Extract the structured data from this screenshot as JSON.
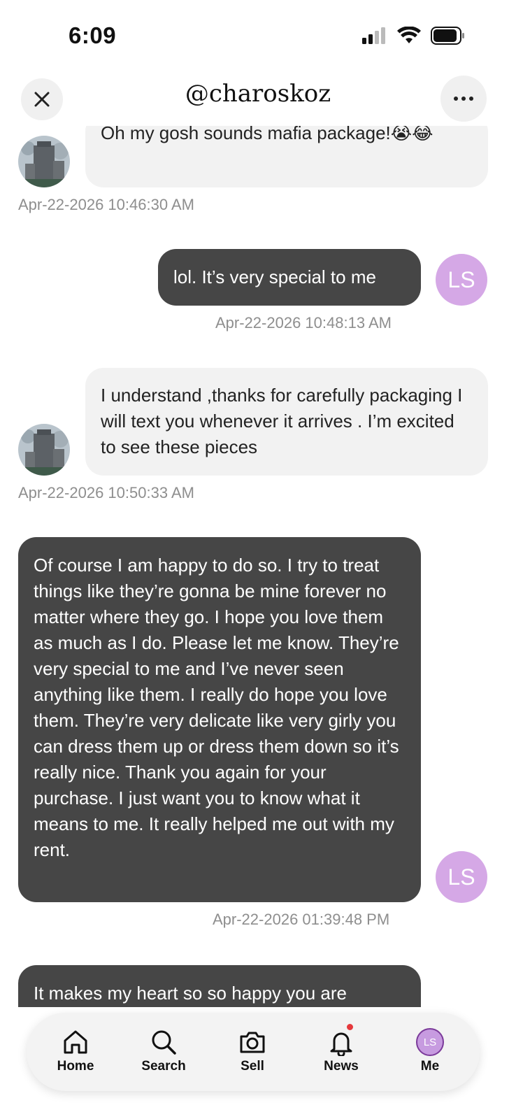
{
  "status_bar": {
    "time": "6:09"
  },
  "header": {
    "title": "@charoskoz",
    "close_icon": "close-icon",
    "more_icon": "more-icon"
  },
  "messages": [
    {
      "side": "incoming",
      "text": "Oh my gosh sounds mafia package!😭😂",
      "timestamp": "Apr-22-2026 10:46:30 AM"
    },
    {
      "side": "outgoing",
      "text": "lol. It’s very special to me",
      "timestamp": "Apr-22-2026 10:48:13 AM",
      "avatar": "LS"
    },
    {
      "side": "incoming",
      "text": "I understand ,thanks for carefully packaging I will text you whenever it arrives . I’m excited to see these pieces",
      "timestamp": "Apr-22-2026 10:50:33 AM"
    },
    {
      "side": "outgoing",
      "text": "Of course I am happy to do so. I try to treat things like they’re gonna be mine forever no matter where they go. I hope you love them as much as I do. Please let me know. They’re very special to me and I’ve never seen anything like them. I really do hope you love them. They’re very delicate like very girly you can dress them up or dress them down so it’s really nice. Thank you again for your purchase. I just want you to know what it means to me. It really helped me out with my rent.",
      "timestamp": "Apr-22-2026 01:39:48 PM",
      "avatar": "LS"
    },
    {
      "side": "outgoing",
      "text": "It makes my heart so so happy you are",
      "partial": true
    }
  ],
  "tabbar": {
    "items": [
      {
        "label": "Home",
        "icon": "home-icon"
      },
      {
        "label": "Search",
        "icon": "search-icon"
      },
      {
        "label": "Sell",
        "icon": "camera-icon"
      },
      {
        "label": "News",
        "icon": "bell-icon",
        "badge_color": "#e5383b"
      },
      {
        "label": "Me",
        "icon": "avatar",
        "avatar_initials": "LS"
      }
    ]
  },
  "colors": {
    "outgoing_bubble": "#464646",
    "incoming_bubble": "#f2f2f2",
    "avatar_ls": "#d5a8e6"
  }
}
